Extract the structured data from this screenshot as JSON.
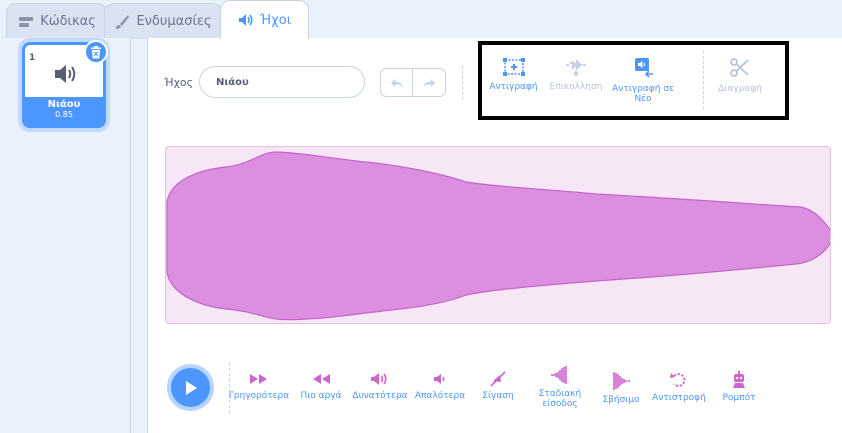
{
  "tabs": [
    {
      "label": "Κώδικας",
      "icon": "code-icon"
    },
    {
      "label": "Ενδυμασίες",
      "icon": "costume-brush-icon"
    },
    {
      "label": "Ήχοι",
      "icon": "speaker-icon"
    }
  ],
  "sound_list": [
    {
      "index": "1",
      "name": "Νιάου",
      "duration": "0.85"
    }
  ],
  "editor": {
    "name_label": "Ήχος",
    "name_value": "Νιάου",
    "tools": [
      {
        "label": "Αντιγραφή",
        "enabled": true
      },
      {
        "label": "Επικόλληση",
        "enabled": false
      },
      {
        "label": "Αντιγραφή σε Νέο",
        "enabled": true
      },
      {
        "label": "Διαγραφή",
        "enabled": false
      }
    ]
  },
  "effects": [
    {
      "label": "Γρηγορότερα"
    },
    {
      "label": "Πιο αργά"
    },
    {
      "label": "Δυνατότερα"
    },
    {
      "label": "Απαλότερα"
    },
    {
      "label": "Σίγαση"
    },
    {
      "label": "Σταδιακή είσοδος"
    },
    {
      "label": "Σβήσιμο"
    },
    {
      "label": "Αντιστροφή"
    },
    {
      "label": "Ρομπότ"
    }
  ],
  "colors": {
    "accent": "#4c97ff",
    "waveform_fill": "#dc8fe0",
    "waveform_bg": "#f6e6f6",
    "effect_icon": "#cf63cf"
  }
}
